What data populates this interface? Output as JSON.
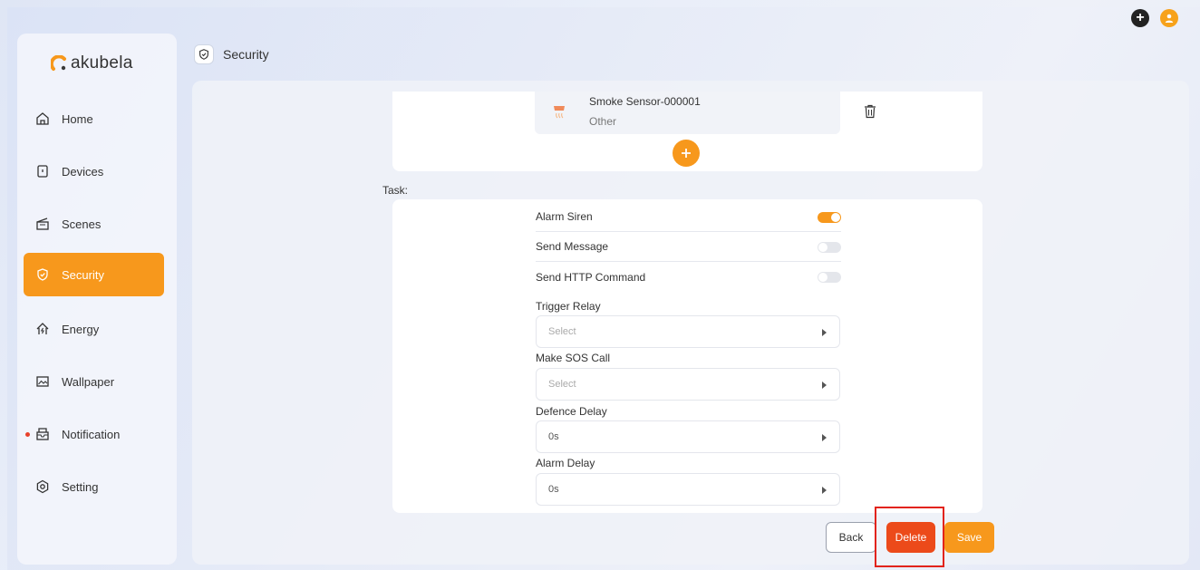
{
  "app": {
    "brand": "akubela",
    "brand_color": "#f7981c"
  },
  "header": {
    "title": "Security"
  },
  "sidebar": {
    "items": [
      {
        "label": "Home",
        "icon": "home-icon"
      },
      {
        "label": "Devices",
        "icon": "devices-icon"
      },
      {
        "label": "Scenes",
        "icon": "scenes-icon"
      },
      {
        "label": "Security",
        "icon": "shield-icon",
        "active": true
      },
      {
        "label": "Energy",
        "icon": "energy-icon"
      },
      {
        "label": "Wallpaper",
        "icon": "wallpaper-icon"
      },
      {
        "label": "Notification",
        "icon": "notification-icon",
        "unread_dot": true
      },
      {
        "label": "Setting",
        "icon": "setting-icon"
      }
    ]
  },
  "trigger": {
    "device_name": "Smoke Sensor-000001",
    "device_type": "Other"
  },
  "task": {
    "label": "Task:",
    "toggles": [
      {
        "label": "Alarm Siren",
        "on": true
      },
      {
        "label": "Send Message",
        "on": false
      },
      {
        "label": "Send HTTP Command",
        "on": false
      }
    ],
    "fields": [
      {
        "label": "Trigger Relay",
        "value": "Select",
        "placeholder": true
      },
      {
        "label": "Make SOS Call",
        "value": "Select",
        "placeholder": true
      },
      {
        "label": "Defence Delay",
        "value": "0s",
        "placeholder": false
      },
      {
        "label": "Alarm Delay",
        "value": "0s",
        "placeholder": false
      }
    ]
  },
  "actions": {
    "back": "Back",
    "delete": "Delete",
    "save": "Save"
  },
  "colors": {
    "accent": "#f7981c",
    "delete": "#ec4a1a",
    "highlight": "#e2231a"
  }
}
